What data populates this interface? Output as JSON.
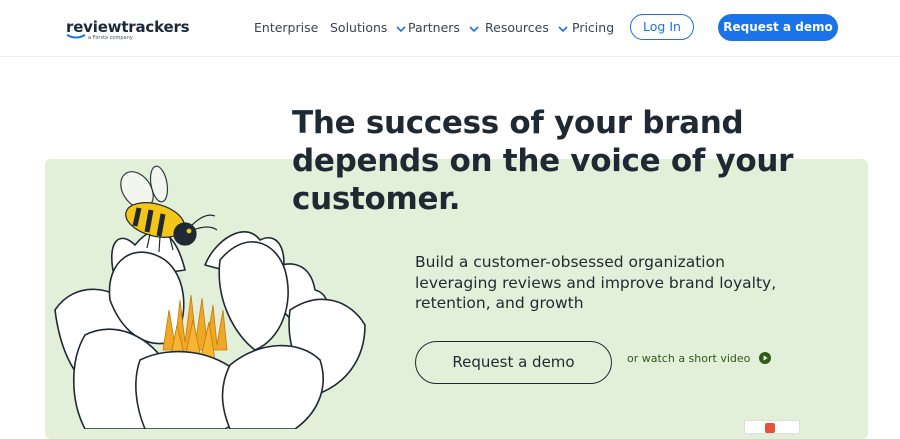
{
  "brand": {
    "name": "reviewtrackers",
    "tagline": "a Forsta company",
    "accent": "#1a73e8"
  },
  "nav": {
    "items": [
      {
        "label": "Enterprise",
        "has_dropdown": false
      },
      {
        "label": "Solutions",
        "has_dropdown": true
      },
      {
        "label": "Partners",
        "has_dropdown": true
      },
      {
        "label": "Resources",
        "has_dropdown": true
      },
      {
        "label": "Pricing",
        "has_dropdown": false
      }
    ],
    "login_label": "Log In",
    "demo_label": "Request a demo"
  },
  "hero": {
    "headline_lines": [
      "The success of your brand",
      "depends on the voice of your",
      "customer."
    ],
    "subtext_lines": [
      "Build a customer-obsessed organization",
      "leveraging reviews and improve brand loyalty,",
      "retention, and growth"
    ],
    "cta_label": "Request a demo",
    "video_link_label": "or watch a short video",
    "panel_color": "#e3f0d9",
    "icons": [
      "bee-illustration",
      "lotus-flower-illustration",
      "play-circle-icon",
      "chevron-down-icon"
    ]
  }
}
